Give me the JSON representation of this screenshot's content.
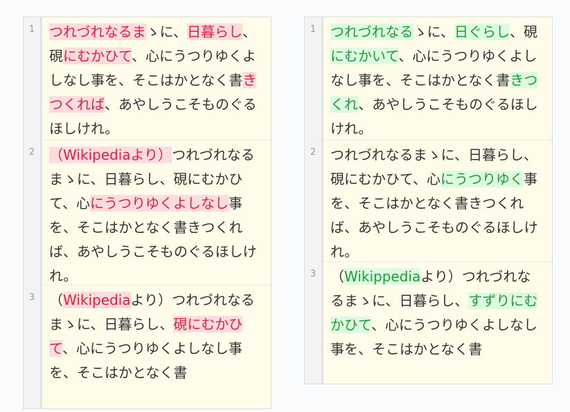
{
  "colors": {
    "pane_background": "#fffcea",
    "gutter_background": "#f3f3f3",
    "text": "#333333",
    "deleted_text": "#e0213a",
    "deleted_background": "#fcdcdf",
    "inserted_text": "#219c32",
    "inserted_background": "#dcfbe0"
  },
  "left": {
    "lines": [
      {
        "number": "1",
        "segments": [
          {
            "text": "つれづれなるま",
            "type": "del"
          },
          {
            "text": "ゝに、",
            "type": "plain"
          },
          {
            "text": "日暮らし",
            "type": "del"
          },
          {
            "text": "、硯",
            "type": "plain"
          },
          {
            "text": "にむかひて",
            "type": "del"
          },
          {
            "text": "、心にうつりゆくよしなし事を、そこはかとなく書",
            "type": "plain"
          },
          {
            "text": "きつくれば",
            "type": "del"
          },
          {
            "text": "、あやしうこそものぐるほしけれ。",
            "type": "plain"
          }
        ]
      },
      {
        "number": "2",
        "segments": [
          {
            "text": "（Wikipediaより）",
            "type": "del"
          },
          {
            "text": "つれづれなるまゝに、日暮らし、硯にむかひて、心",
            "type": "plain"
          },
          {
            "text": "にうつりゆくよしなし",
            "type": "del"
          },
          {
            "text": "事を、そこはかとなく書きつくれば、あやしうこそものぐるほしけれ。",
            "type": "plain"
          }
        ]
      },
      {
        "number": "3",
        "segments": [
          {
            "text": "（",
            "type": "plain"
          },
          {
            "text": "Wikipedia",
            "type": "del"
          },
          {
            "text": "より）つれづれなるまゝに、日暮らし、",
            "type": "plain"
          },
          {
            "text": "硯にむかひて",
            "type": "del"
          },
          {
            "text": "、心にうつりゆくよしなし事を、そこはかとなく書",
            "type": "plain"
          }
        ]
      }
    ]
  },
  "right": {
    "lines": [
      {
        "number": "1",
        "segments": [
          {
            "text": "つれづれなる",
            "type": "ins"
          },
          {
            "text": "ゝに、",
            "type": "plain"
          },
          {
            "text": "日ぐらし",
            "type": "ins"
          },
          {
            "text": "、硯",
            "type": "plain"
          },
          {
            "text": "にむかいて",
            "type": "ins"
          },
          {
            "text": "、心にうつりゆくよしなし事を、そこはかとなく書",
            "type": "plain"
          },
          {
            "text": "きつくれ",
            "type": "ins"
          },
          {
            "text": "、あやしうこそものぐるほしけれ。",
            "type": "plain"
          }
        ]
      },
      {
        "number": "2",
        "segments": [
          {
            "text": "つれづれなるまゝに、日暮らし、硯にむかひて、心",
            "type": "plain"
          },
          {
            "text": "にうつりゆく",
            "type": "ins"
          },
          {
            "text": "事を、そこはかとなく書きつくれば、あやしうこそものぐるほしけれ。",
            "type": "plain"
          }
        ]
      },
      {
        "number": "3",
        "segments": [
          {
            "text": "（",
            "type": "plain"
          },
          {
            "text": "Wikippedia",
            "type": "ins"
          },
          {
            "text": "より）つれづれなるまゝに、日暮らし、",
            "type": "plain"
          },
          {
            "text": "すずりにむかひて",
            "type": "ins"
          },
          {
            "text": "、心にうつりゆくよしなし事を、そこはかとなく書",
            "type": "plain"
          }
        ]
      }
    ]
  }
}
